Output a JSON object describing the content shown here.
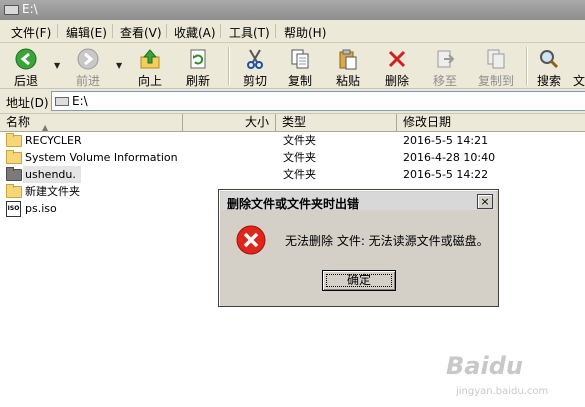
{
  "window": {
    "title": "E:\\"
  },
  "menu": [
    "文件(F)",
    "编辑(E)",
    "查看(V)",
    "收藏(A)",
    "工具(T)",
    "帮助(H)"
  ],
  "toolbar": {
    "back": "后退",
    "forward": "前进",
    "up": "向上",
    "refresh": "刷新",
    "cut": "剪切",
    "copy": "复制",
    "paste": "粘贴",
    "delete": "删除",
    "move_to": "移至",
    "copy_to": "复制到",
    "search": "搜索",
    "extra": "文"
  },
  "address": {
    "label": "地址(D)",
    "value": "E:\\"
  },
  "columns": {
    "name": "名称",
    "size": "大小",
    "type": "类型",
    "modified": "修改日期"
  },
  "files": [
    {
      "name": "RECYCLER",
      "type": "文件夹",
      "modified": "2016-5-5 14:21"
    },
    {
      "name": "System Volume Information",
      "type": "文件夹",
      "modified": "2016-4-28 10:40"
    },
    {
      "name": "ushendu.",
      "type": "文件夹",
      "modified": "2016-5-5 14:22"
    },
    {
      "name": "新建文件夹",
      "type": "",
      "modified": ""
    },
    {
      "name": "ps.iso",
      "type": "",
      "modified": ""
    }
  ],
  "dialog": {
    "title": "删除文件或文件夹时出错",
    "message": "无法删除 文件: 无法读源文件或磁盘。",
    "ok": "确定",
    "close": "×"
  },
  "watermark": {
    "brand": "Baidu",
    "url": "jingyan.baidu.com"
  }
}
